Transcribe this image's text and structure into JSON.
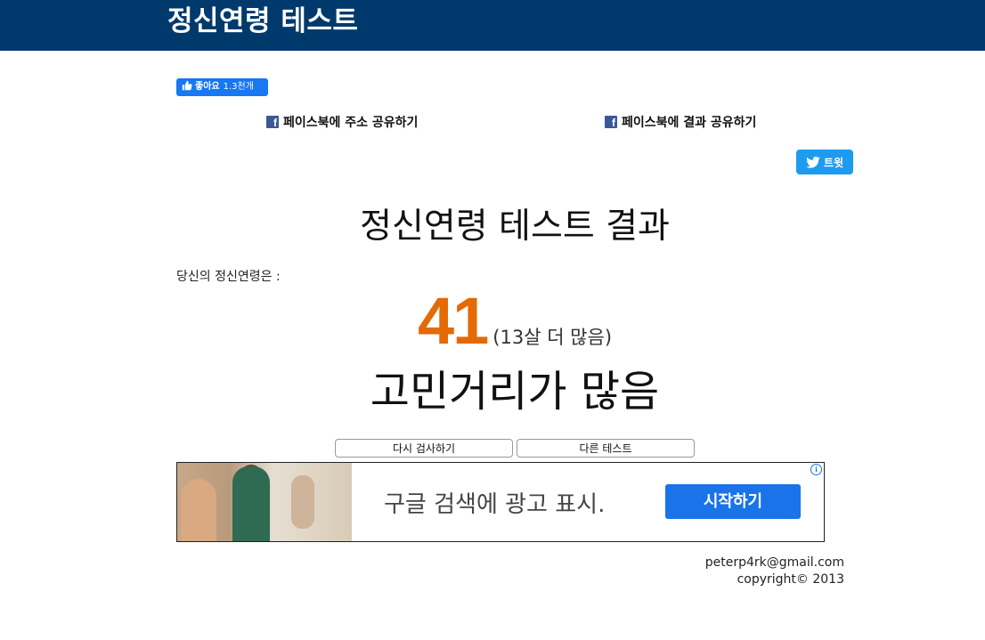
{
  "header": {
    "title": "정신연령 테스트"
  },
  "social": {
    "like_label": "좋아요",
    "like_count": "1.3천개",
    "share_address": "페이스북에 주소 공유하기",
    "share_result": "페이스북에 결과 공유하기",
    "tweet_label": "트윗"
  },
  "result": {
    "title": "정신연령 테스트 결과",
    "intro": "당신의 정신연령은 :",
    "age": "41",
    "age_diff": "(13살 더 많음)",
    "verdict": "고민거리가 많음"
  },
  "actions": {
    "retry": "다시 검사하기",
    "other": "다른 테스트"
  },
  "ad": {
    "text": "구글 검색에 광고 표시.",
    "button": "시작하기",
    "info_glyph": "i"
  },
  "footer": {
    "email": "peterp4rk@gmail.com",
    "copyright": "copyright© 2013"
  },
  "colors": {
    "header_bg": "#003a6c",
    "age_accent": "#e46a05",
    "facebook": "#1877f2",
    "twitter": "#1d9bf0",
    "ad_button": "#1a73e8"
  }
}
